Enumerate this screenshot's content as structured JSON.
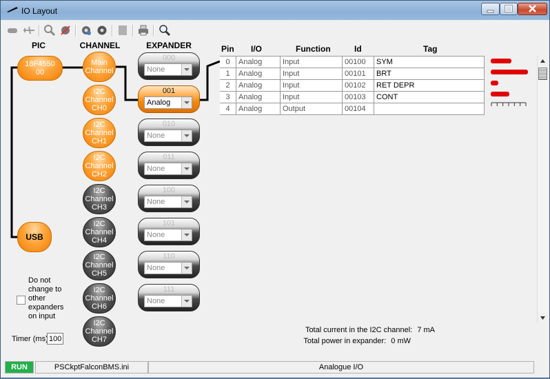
{
  "window": {
    "title": "IO Layout"
  },
  "columns": {
    "pic": "PIC",
    "channel": "CHANNEL",
    "expander": "EXPANDER"
  },
  "pic": {
    "line1": "18F4550",
    "line2": "00"
  },
  "usb": "USB",
  "channels": [
    {
      "l1": "Main",
      "l2": "Channel",
      "l3": "",
      "state": "orange"
    },
    {
      "l1": "I2C",
      "l2": "Channel",
      "l3": "CH0",
      "state": "orange"
    },
    {
      "l1": "I2C",
      "l2": "Channel",
      "l3": "CH1",
      "state": "orange"
    },
    {
      "l1": "I2C",
      "l2": "Channel",
      "l3": "CH2",
      "state": "orange"
    },
    {
      "l1": "I2C",
      "l2": "Channel",
      "l3": "CH3",
      "state": "gray"
    },
    {
      "l1": "I2C",
      "l2": "Channel",
      "l3": "CH4",
      "state": "gray"
    },
    {
      "l1": "I2C",
      "l2": "Channel",
      "l3": "CH5",
      "state": "gray"
    },
    {
      "l1": "I2C",
      "l2": "Channel",
      "l3": "CH6",
      "state": "gray"
    },
    {
      "l1": "I2C",
      "l2": "Channel",
      "l3": "CH7",
      "state": "gray"
    }
  ],
  "expanders": [
    {
      "num": "000",
      "value": "None",
      "state": "gray"
    },
    {
      "num": "001",
      "value": "Analog",
      "state": "orange"
    },
    {
      "num": "010",
      "value": "None",
      "state": "gray"
    },
    {
      "num": "011",
      "value": "None",
      "state": "gray"
    },
    {
      "num": "100",
      "value": "None",
      "state": "gray"
    },
    {
      "num": "101",
      "value": "None",
      "state": "gray"
    },
    {
      "num": "110",
      "value": "None",
      "state": "gray"
    },
    {
      "num": "111",
      "value": "None",
      "state": "gray"
    }
  ],
  "options": {
    "no_change_label": [
      "Do not",
      "change to",
      "other",
      "expanders",
      "on input"
    ],
    "no_change_checked": false,
    "timer_label": "Timer (ms)",
    "timer_value": "100"
  },
  "table": {
    "headers": {
      "pin": "Pin",
      "io": "I/O",
      "function": "Function",
      "id": "Id",
      "tag": "Tag"
    },
    "rows": [
      {
        "pin": "0",
        "io": "Analog",
        "function": "Input",
        "id": "00100",
        "tag": "SYM",
        "level": 0.55
      },
      {
        "pin": "1",
        "io": "Analog",
        "function": "Input",
        "id": "00101",
        "tag": "BRT",
        "level": 1.0
      },
      {
        "pin": "2",
        "io": "Analog",
        "function": "Input",
        "id": "00102",
        "tag": "RET DEPR",
        "level": 0.2
      },
      {
        "pin": "3",
        "io": "Analog",
        "function": "Input",
        "id": "00103",
        "tag": "CONT",
        "level": 0.5
      },
      {
        "pin": "4",
        "io": "Analog",
        "function": "Output",
        "id": "00104",
        "tag": "",
        "level": null
      }
    ],
    "bar_color": "#e00000"
  },
  "summary": {
    "current_label": "Total current in the I2C channel:",
    "current_value": "7 mA",
    "power_label": "Total power in expander:",
    "power_value": "0 mW"
  },
  "status": {
    "run": "RUN",
    "file": "PSCkptFalconBMS.ini",
    "mode": "Analogue I/O",
    "run_color": "#22b04a"
  }
}
